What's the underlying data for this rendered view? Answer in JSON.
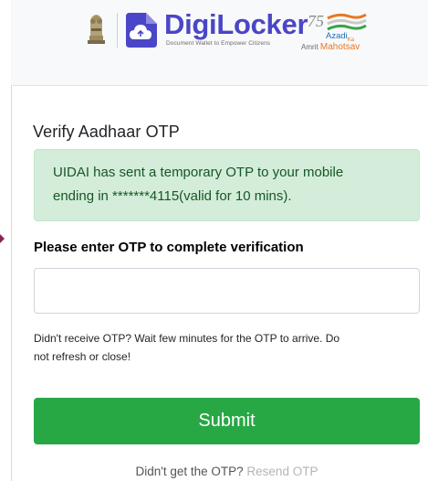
{
  "header": {
    "brand_name": "DigiLocker",
    "brand_tagline": "Document Wallet to Empower Citizens",
    "azadi_number": "75",
    "azadi_line1": "Azadi",
    "azadi_ka": "Ka",
    "azadi_amrit": "Amrit",
    "azadi_mahotsav": "Mahotsav",
    "emblem_icon": "national-emblem-icon",
    "logo_icon": "digilocker-cloud-icon",
    "colors": {
      "brand": "#4a46c7",
      "saffron": "#e87722",
      "azadi_blue": "#1a6fb8"
    }
  },
  "verify": {
    "title": "Verify Aadhaar OTP",
    "alert_line1": "UIDAI has sent a temporary OTP to your mobile",
    "alert_line2": "ending in *******4115(valid for 10 mins).",
    "otp_label": "Please enter OTP to complete verification",
    "otp_value": "",
    "help_line1": "Didn't receive OTP? Wait few minutes for the OTP to arrive. Do",
    "help_line2": "not refresh or close!",
    "submit_label": "Submit",
    "resend_prompt": "Didn't get the OTP?",
    "resend_link": "Resend OTP",
    "colors": {
      "success": "#28a745",
      "alert_bg": "#d4edda",
      "alert_text": "#155724"
    }
  }
}
